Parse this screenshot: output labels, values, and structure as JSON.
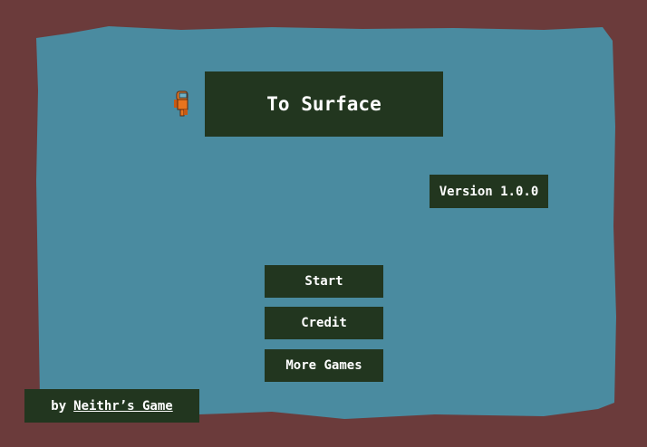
{
  "game": {
    "title": "To Surface",
    "version": "Version 1.0.0"
  },
  "menu": {
    "start_label": "Start",
    "credit_label": "Credit",
    "more_games_label": "More Games"
  },
  "footer": {
    "by_label": "by",
    "author_link": "Neithr’s Game"
  },
  "sprites": {
    "player": "astronaut-player-icon"
  },
  "colors": {
    "border": "#6b3b3b",
    "water": "#4a8ba0",
    "panel": "#22361f",
    "text": "#ffffff",
    "player_suit": "#e8741e"
  }
}
